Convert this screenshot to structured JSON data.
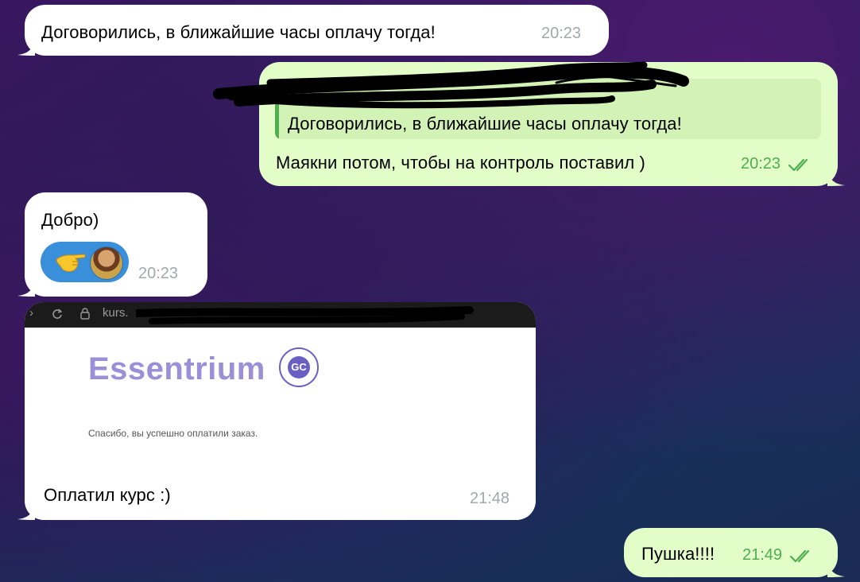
{
  "messages": [
    {
      "id": "m1",
      "direction": "incoming",
      "text": "Договорились, в ближайшие часы оплачу тогда!",
      "time": "20:23"
    },
    {
      "id": "m2",
      "direction": "outgoing",
      "reply_quote": {
        "text": "Договорились, в ближайшие часы оплачу тогда!"
      },
      "text": "Маякни потом, чтобы на контроль поставил )",
      "time": "20:23",
      "status": "read"
    },
    {
      "id": "m3",
      "direction": "incoming",
      "text": "Добро)",
      "time": "20:23",
      "reaction": {
        "emoji": "pointing-hand-emoji",
        "avatar": "user-avatar"
      }
    },
    {
      "id": "m4",
      "direction": "incoming",
      "type": "photo",
      "photo": {
        "browser_url": "kurs.",
        "brand": "Essentrium",
        "badge": "GC",
        "thanks_text": "Спасибо, вы успешно оплатили заказ."
      },
      "text": "Оплатил курс :)",
      "time": "21:48"
    },
    {
      "id": "m5",
      "direction": "outgoing",
      "text": "Пушка!!!!",
      "time": "21:49",
      "status": "read"
    }
  ],
  "colors": {
    "incoming_bubble": "#ffffff",
    "outgoing_bubble": "#e3fdc9",
    "accent_green": "#4fae4e",
    "reaction_blue": "#3a8fdb",
    "brand_purple": "#9b8fd8"
  }
}
